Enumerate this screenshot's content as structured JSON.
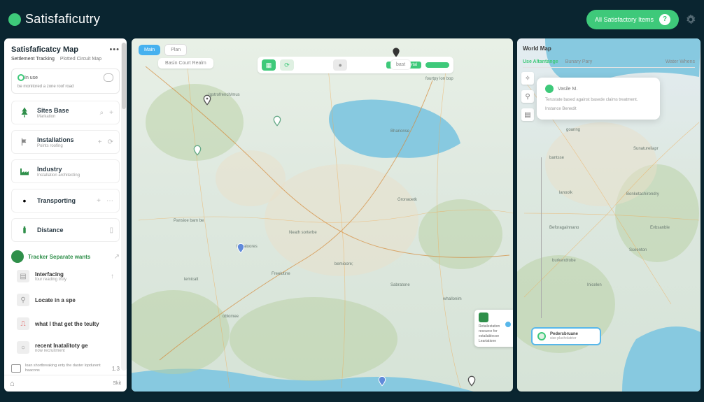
{
  "app": {
    "name": "Satisfaficutry",
    "top_button": "All Satisfactory Items",
    "top_button_badge": "?"
  },
  "sidebar": {
    "title": "Satisfaficatcy Map",
    "subtabs": [
      "Settlement Tracking",
      "Plotted Circuit Map"
    ],
    "hint_label": "In use",
    "hint_text": "be monitored a zone roof road",
    "cards": [
      {
        "title": "Sites Base",
        "sub": "Markation"
      },
      {
        "title": "Installations",
        "sub": "Points roofing"
      },
      {
        "title": "Industry",
        "sub": "Installation architecting"
      },
      {
        "title": "Transporting",
        "sub": ""
      },
      {
        "title": "Distance",
        "sub": ""
      }
    ],
    "section": {
      "title": "Tracker Separate wants",
      "items": [
        {
          "title": "Interfacing",
          "sub": "four reading truly"
        },
        {
          "title": "Locate in a spe",
          "sub": ""
        },
        {
          "title": "what I that get the teulty",
          "sub": ""
        },
        {
          "title": "recent Inatalitoty ge",
          "sub": "now recruitment"
        }
      ]
    },
    "foot1": "loan shortbreaking enty the daster lopdurent haacons",
    "foot2": "1.3",
    "footer_status": "Skit"
  },
  "midmap": {
    "tab1": "Main",
    "tab2": "Plan",
    "crumb": "Basin Court Realm",
    "toolbar_chip1": "detailed portal",
    "toolbar_chip2": "bast",
    "popup": {
      "lines": [
        "Retailestation",
        "resource for",
        "estailablecoe",
        "Leartatione"
      ]
    }
  },
  "rightmap": {
    "title": "World Map",
    "tabs": [
      "Use Altantange",
      "Bunary Pary",
      "Water Whens"
    ],
    "tooltip": {
      "head": "Vasile M.",
      "line1": "Terustate based against basede claims treatment.",
      "line2": "Instance Benedit"
    },
    "popup": {
      "title": "Pedersbruane",
      "sub": "size plucholatrier"
    }
  }
}
